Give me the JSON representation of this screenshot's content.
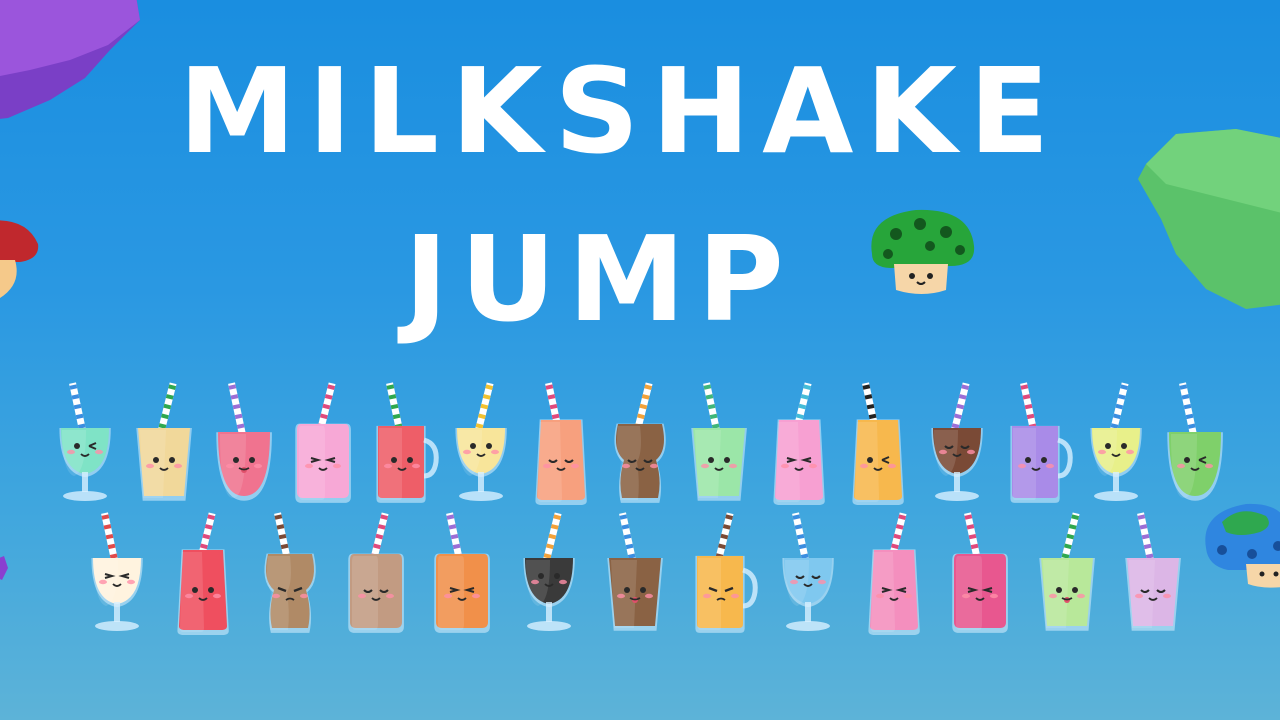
{
  "title": {
    "line1": "MILKSHAKE",
    "line2": "JUMP"
  },
  "colors": {
    "sky_top": "#1a8ee0",
    "sky_bottom": "#5db3d8",
    "title_text": "#ffffff"
  },
  "decorations": [
    "purple-rock-icon",
    "green-bush-icon",
    "red-mushroom-icon",
    "green-mushroom-icon",
    "blue-mushroom-icon"
  ],
  "drinks_row1": [
    {
      "icon": "mint-drink-icon",
      "fill": "#7fe3c6",
      "shape": "goblet",
      "straw": "#3b8ee0",
      "face": "wink"
    },
    {
      "icon": "vanilla-sundae-icon",
      "fill": "#f1d89a",
      "shape": "cup",
      "straw": "#2fa84f",
      "face": "happy"
    },
    {
      "icon": "strawberry-bowl-icon",
      "fill": "#f0738f",
      "shape": "bowl",
      "straw": "#9b6fd6",
      "face": "tongue"
    },
    {
      "icon": "pink-smoothie-icon",
      "fill": "#f7a8d6",
      "shape": "jar",
      "straw": "#e04a7d",
      "face": "squint"
    },
    {
      "icon": "watermelon-mug-icon",
      "fill": "#ee5e68",
      "shape": "mug",
      "straw": "#2fa84f",
      "face": "happy"
    },
    {
      "icon": "lemon-drink-icon",
      "fill": "#f8e59a",
      "shape": "goblet",
      "straw": "#f2c230",
      "face": "happy"
    },
    {
      "icon": "peach-drink-icon",
      "fill": "#f7a07e",
      "shape": "tall",
      "straw": "#e04a7d",
      "face": "calm"
    },
    {
      "icon": "cookie-shake-icon",
      "fill": "#8a6244",
      "shape": "vase",
      "straw": "#f2a23a",
      "face": "calm"
    },
    {
      "icon": "melon-float-icon",
      "fill": "#9be6a8",
      "shape": "cup",
      "straw": "#3fb67a",
      "face": "happy"
    },
    {
      "icon": "pink-lemonade-icon",
      "fill": "#f7a0d2",
      "shape": "tall",
      "straw": "#44bcd8",
      "face": "squint"
    },
    {
      "icon": "mango-drink-icon",
      "fill": "#f7b84d",
      "shape": "tall",
      "straw": "#222222",
      "face": "wink"
    },
    {
      "icon": "chocolate-cone-icon",
      "fill": "#7a4a36",
      "shape": "goblet",
      "straw": "#9b6fd6",
      "face": "smirk"
    },
    {
      "icon": "grape-mug-icon",
      "fill": "#a98be8",
      "shape": "mug",
      "straw": "#e04a7d",
      "face": "happy"
    },
    {
      "icon": "lemonade-icon",
      "fill": "#e8f08a",
      "shape": "goblet",
      "straw": "#3b8ee0",
      "face": "happy"
    },
    {
      "icon": "matcha-drink-icon",
      "fill": "#7fd06a",
      "shape": "bowl",
      "straw": "#3b8ee0",
      "face": "wink"
    }
  ],
  "drinks_row2": [
    {
      "icon": "vanilla-goblet-icon",
      "fill": "#fff3df",
      "shape": "goblet",
      "straw": "#e04a4a",
      "face": "squint"
    },
    {
      "icon": "cherry-soda-icon",
      "fill": "#ef4f5f",
      "shape": "tall",
      "straw": "#e04a7d",
      "face": "happy"
    },
    {
      "icon": "coffee-cup-icon",
      "fill": "#b08a66",
      "shape": "vase",
      "straw": "#7a4a36",
      "face": "grumpy"
    },
    {
      "icon": "latte-jar-icon",
      "fill": "#c29b82",
      "shape": "jar",
      "straw": "#e04a7d",
      "face": "calm"
    },
    {
      "icon": "orange-shake-icon",
      "fill": "#f1904a",
      "shape": "jar",
      "straw": "#9b6fd6",
      "face": "squint"
    },
    {
      "icon": "dark-cocoa-icon",
      "fill": "#3a3a3a",
      "shape": "goblet",
      "straw": "#f2a23a",
      "face": "happy"
    },
    {
      "icon": "cookies-cream-icon",
      "fill": "#8a6244",
      "shape": "cup",
      "straw": "#3b8ee0",
      "face": "tongue"
    },
    {
      "icon": "orange-mug-icon",
      "fill": "#f7b84d",
      "shape": "mug",
      "straw": "#7a4a36",
      "face": "grumpy"
    },
    {
      "icon": "blue-soda-icon",
      "fill": "#7fc8ef",
      "shape": "goblet",
      "straw": "#3b8ee0",
      "face": "calm"
    },
    {
      "icon": "bubblegum-shake-icon",
      "fill": "#f48fbe",
      "shape": "tall",
      "straw": "#e04a7d",
      "face": "squint"
    },
    {
      "icon": "raspberry-drink-icon",
      "fill": "#e8578f",
      "shape": "jar",
      "straw": "#e04a7d",
      "face": "squint"
    },
    {
      "icon": "lime-float-icon",
      "fill": "#b8e89a",
      "shape": "cup",
      "straw": "#2fa84f",
      "face": "tongue"
    },
    {
      "icon": "taro-boba-icon",
      "fill": "#dcb6e6",
      "shape": "cup",
      "straw": "#9b6fd6",
      "face": "calm"
    }
  ]
}
